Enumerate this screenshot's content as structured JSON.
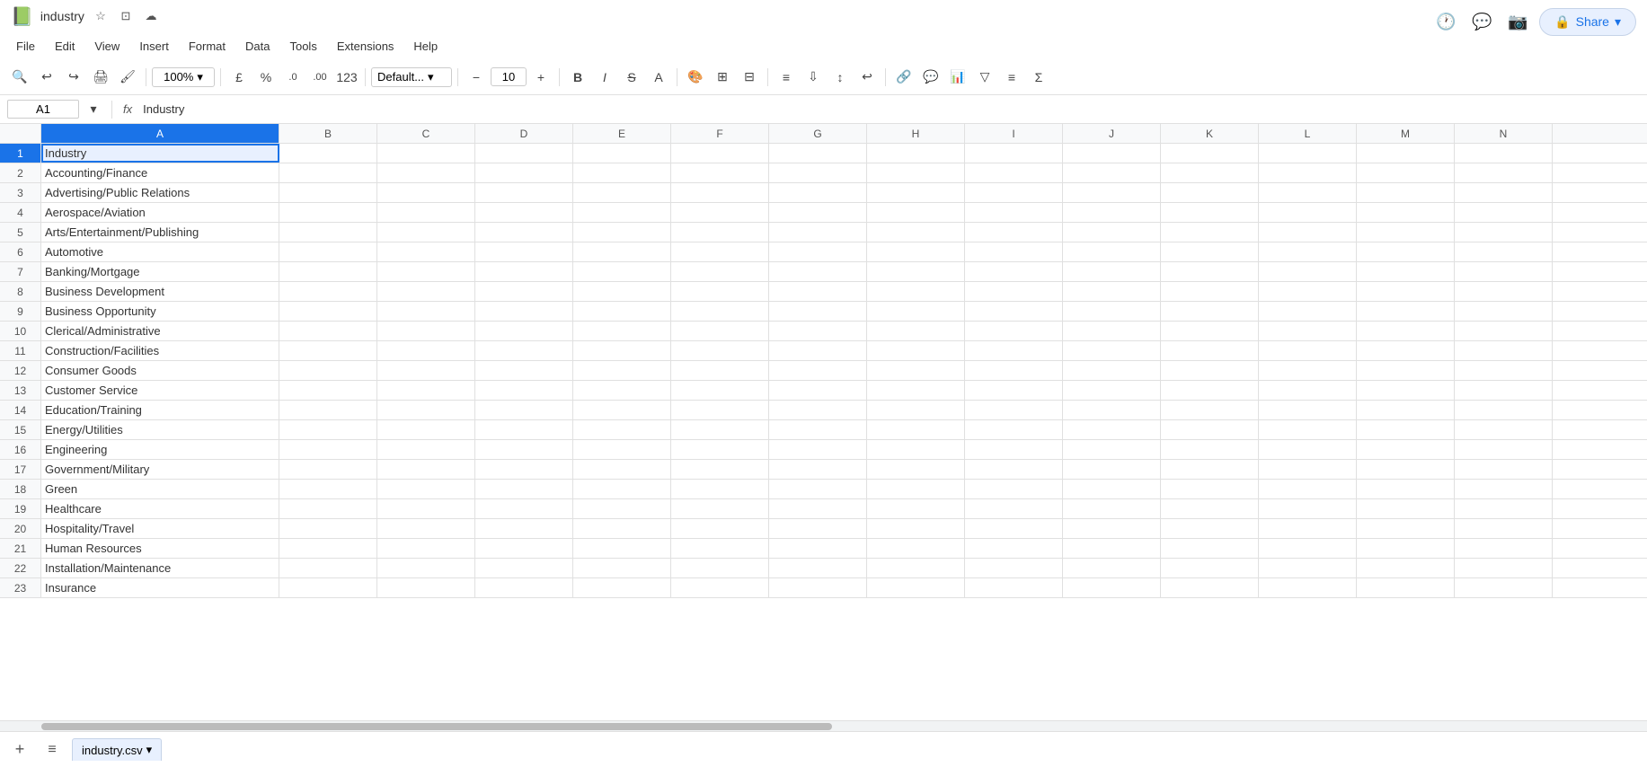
{
  "titleBar": {
    "fileName": "industry",
    "appIcon": "📗"
  },
  "menu": {
    "items": [
      "File",
      "Edit",
      "View",
      "Insert",
      "Format",
      "Data",
      "Tools",
      "Extensions",
      "Help"
    ]
  },
  "toolbar": {
    "zoom": "100%",
    "currency": "£",
    "percent": "%",
    "decimalDecrease": ".0",
    "decimalIncrease": ".00",
    "number123": "123",
    "fontFamily": "Default...",
    "fontSize": "10",
    "bold": "B",
    "italic": "I",
    "strikethrough": "S"
  },
  "formulaBar": {
    "cellRef": "A1",
    "formula": "Industry"
  },
  "columns": [
    "A",
    "B",
    "C",
    "D",
    "E",
    "F",
    "G",
    "H",
    "I",
    "J",
    "K",
    "L",
    "M",
    "N"
  ],
  "rows": [
    {
      "num": 1,
      "a": "Industry"
    },
    {
      "num": 2,
      "a": "Accounting/Finance"
    },
    {
      "num": 3,
      "a": "Advertising/Public Relations"
    },
    {
      "num": 4,
      "a": "Aerospace/Aviation"
    },
    {
      "num": 5,
      "a": "Arts/Entertainment/Publishing"
    },
    {
      "num": 6,
      "a": "Automotive"
    },
    {
      "num": 7,
      "a": "Banking/Mortgage"
    },
    {
      "num": 8,
      "a": "Business Development"
    },
    {
      "num": 9,
      "a": "Business Opportunity"
    },
    {
      "num": 10,
      "a": "Clerical/Administrative"
    },
    {
      "num": 11,
      "a": "Construction/Facilities"
    },
    {
      "num": 12,
      "a": "Consumer Goods"
    },
    {
      "num": 13,
      "a": "Customer Service"
    },
    {
      "num": 14,
      "a": "Education/Training"
    },
    {
      "num": 15,
      "a": "Energy/Utilities"
    },
    {
      "num": 16,
      "a": "Engineering"
    },
    {
      "num": 17,
      "a": "Government/Military"
    },
    {
      "num": 18,
      "a": "Green"
    },
    {
      "num": 19,
      "a": "Healthcare"
    },
    {
      "num": 20,
      "a": "Hospitality/Travel"
    },
    {
      "num": 21,
      "a": "Human Resources"
    },
    {
      "num": 22,
      "a": "Installation/Maintenance"
    },
    {
      "num": 23,
      "a": "Insurance"
    }
  ],
  "bottomBar": {
    "addSheetLabel": "+",
    "sheetsMenuLabel": "≡",
    "sheetName": "industry.csv",
    "sheetDropdown": "▾"
  },
  "topRight": {
    "shareLabel": "Share",
    "lockIcon": "🔒"
  }
}
